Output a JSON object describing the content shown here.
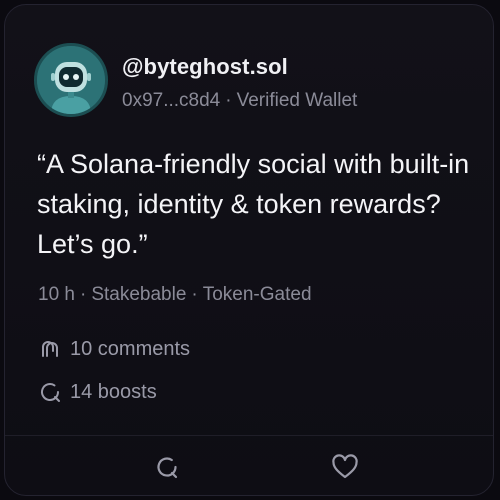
{
  "post": {
    "author": {
      "handle": "@byteghost.sol",
      "wallet": "0x97...c8d4",
      "wallet_status": "Verified Wallet",
      "avatar_icon": "robot-avatar"
    },
    "quote": "“A Solana-friendly social with built-in staking, identity & token rewards? Let’s go.”",
    "meta": {
      "time": "10 h",
      "tag1": "Stakebable",
      "tag2": "Token-Gated",
      "separator": "·"
    },
    "stats": {
      "comments": "10 comments",
      "boosts": "14 boosts"
    }
  },
  "actions": {
    "comment_icon": "comment-icon",
    "like_icon": "heart-icon"
  },
  "colors": {
    "background": "#0b0a10",
    "card": "#121118",
    "avatar": "#2a6f73",
    "text_primary": "#f0f0f4",
    "text_muted": "#8b8b98"
  }
}
